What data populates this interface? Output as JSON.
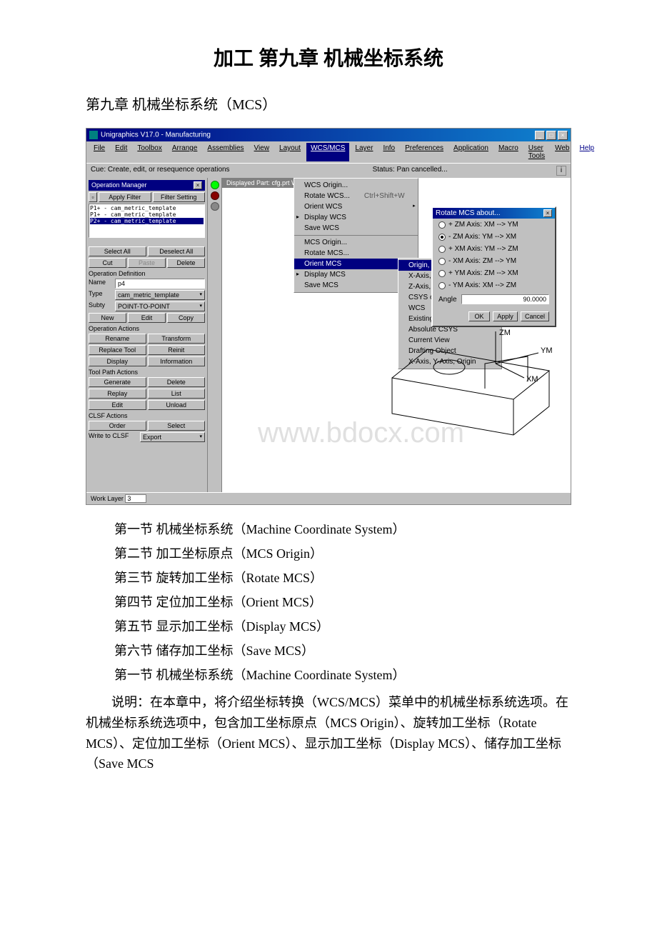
{
  "doc": {
    "title": "加工 第九章 机械坐标系统",
    "subtitle": "第九章 机械坐标系统（MCS）",
    "toc": [
      "第一节 机械坐标系统（Machine Coordinate System）",
      "第二节 加工坐标原点（MCS Origin）",
      "第三节 旋转加工坐标（Rotate MCS）",
      "第四节 定位加工坐标（Orient MCS）",
      "第五节 显示加工坐标（Display MCS）",
      "第六节 储存加工坐标（Save MCS）",
      "第一节 机械坐标系统（Machine Coordinate System）"
    ],
    "paragraph": "说明：在本章中，将介绍坐标转换（WCS/MCS）菜单中的机械坐标系统选项。在机械坐标系统选项中，包含加工坐标原点（MCS Origin）、旋转加工坐标（Rotate MCS）、定位加工坐标（Orient MCS）、显示加工坐标（Display MCS）、储存加工坐标（Save MCS"
  },
  "app": {
    "title": "Unigraphics V17.0 - Manufacturing",
    "menus": [
      "File",
      "Edit",
      "Toolbox",
      "Arrange",
      "Assemblies",
      "View",
      "Layout",
      "WCS/MCS",
      "Layer",
      "Info",
      "Preferences",
      "Application",
      "Macro",
      "User Tools",
      "Web"
    ],
    "help": "Help",
    "cue": "Cue: Create, edit, or resequence operations",
    "status_label": "Status:",
    "status_text": "Pan cancelled...",
    "canvas_title": "Displayed Part: cfg.prt   Wo",
    "work_layer_label": "Work Layer",
    "work_layer_value": "3",
    "watermark": "www.bdocx.com"
  },
  "wcsMenu": {
    "items": [
      {
        "label": "WCS Origin..."
      },
      {
        "label": "Rotate WCS...",
        "shortcut": "Ctrl+Shift+W"
      },
      {
        "label": "Orient WCS",
        "arrow": true
      },
      {
        "label": "Display WCS",
        "checked": true
      },
      {
        "label": "Save WCS"
      },
      {
        "label": "MCS Origin...",
        "sep": true
      },
      {
        "label": "Rotate MCS..."
      },
      {
        "label": "Orient MCS",
        "arrow": true,
        "highlight": true
      },
      {
        "label": "Display MCS",
        "checked": true
      },
      {
        "label": "Save MCS"
      }
    ]
  },
  "orientMenu": {
    "items": [
      "Origin, X-Point, Y-Point",
      "X-Axis, Y-Axis",
      "Z-Axis, X-Point",
      "CSYS of Arc/Conic/Plane",
      "WCS",
      "Existing CSYS",
      "Absolute CSYS",
      "Current View",
      "Drafting Object",
      "X-Axis, Y-Axis, Origin"
    ]
  },
  "rotateDialog": {
    "title": "Rotate MCS about...",
    "options": [
      "+ ZM Axis:  XM --> YM",
      "- ZM Axis:  YM --> XM",
      "+ XM Axis:  YM --> ZM",
      "- XM Axis:  ZM --> YM",
      "+ YM Axis:  ZM --> XM",
      "- YM Axis:  XM --> ZM"
    ],
    "selected_index": 1,
    "angle_label": "Angle",
    "angle_value": "90.0000",
    "ok": "OK",
    "apply": "Apply",
    "cancel": "Cancel"
  },
  "opManager": {
    "title": "Operation Manager",
    "apply_filter": "Apply Filter",
    "filter_setting": "Filter Setting",
    "list": [
      "P1+ - cam_metric_template",
      "P1+ - cam_metric_template",
      "P2+ - cam_metric_template"
    ],
    "select_all": "Select All",
    "deselect_all": "Deselect All",
    "cut": "Cut",
    "paste": "Paste",
    "delete": "Delete",
    "op_def": "Operation Definition",
    "name_label": "Name",
    "name_value": "p4",
    "type_label": "Type",
    "type_value": "cam_metric_template",
    "subtype_label": "Subty",
    "subtype_value": "POINT-TO-POINT",
    "new": "New",
    "edit": "Edit",
    "copy": "Copy",
    "op_actions": "Operation Actions",
    "rename": "Rename",
    "transform": "Transform",
    "replace_tool": "Replace Tool",
    "reinit": "Reinit",
    "display": "Display",
    "information": "Information",
    "tp_actions": "Tool Path Actions",
    "generate": "Generate",
    "tp_delete": "Delete",
    "replay": "Replay",
    "list_btn": "List",
    "tp_edit": "Edit",
    "unload": "Unload",
    "clsf": "CLSF Actions",
    "order": "Order",
    "select": "Select",
    "write_clsf": "Write to CLSF",
    "export": "Export"
  },
  "axes": {
    "zm": "ZM",
    "ym": "YM",
    "xm": "XM"
  }
}
